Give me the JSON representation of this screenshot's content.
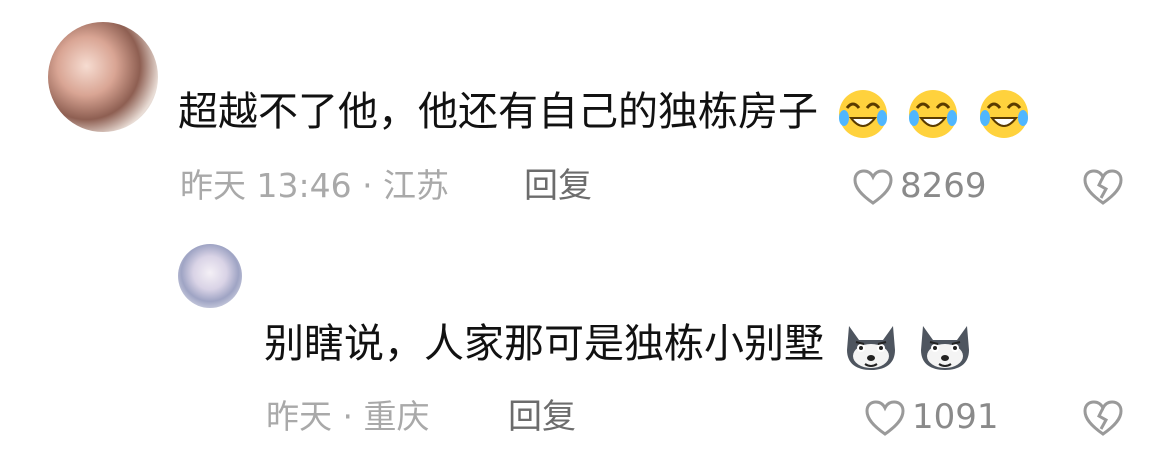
{
  "comments": [
    {
      "text": "超越不了他，他还有自己的独栋房子",
      "emojis": [
        "laugh-cry-emoji",
        "laugh-cry-emoji",
        "laugh-cry-emoji"
      ],
      "time_location": "昨天 13:46 · 江苏",
      "reply_label": "回复",
      "likes": "8269"
    },
    {
      "text": "别瞎说，人家那可是独栋小别墅",
      "emojis": [
        "doge-emoji",
        "doge-emoji"
      ],
      "time_location": "昨天 · 重庆",
      "reply_label": "回复",
      "likes": "1091"
    }
  ],
  "colors": {
    "meta": "#a9a9a9",
    "text": "#111111",
    "reply": "#6c6c6c",
    "like": "#8a8a8a"
  }
}
